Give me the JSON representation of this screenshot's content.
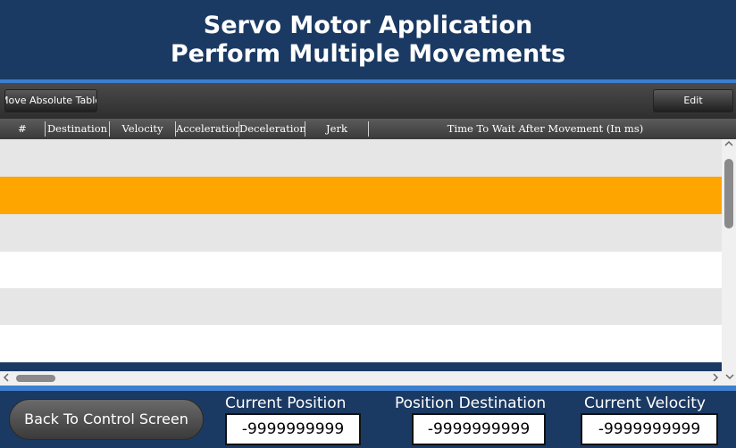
{
  "header": {
    "title_line1": "Servo Motor Application",
    "title_line2": "Perform Multiple Movements"
  },
  "toolbar": {
    "move_label": "Move Absolute Table",
    "edit_label": "Edit"
  },
  "table": {
    "columns": [
      "#",
      "Destination",
      "Velocity",
      "Acceleration",
      "Deceleration",
      "Jerk",
      "Time To Wait After Movement (In ms)"
    ],
    "rows": [
      {
        "state": "normal",
        "color": "#e6e6e6"
      },
      {
        "state": "selected",
        "color": "#ffa500"
      },
      {
        "state": "normal",
        "color": "#e6e6e6"
      },
      {
        "state": "normal",
        "color": "#ffffff"
      },
      {
        "state": "normal",
        "color": "#e6e6e6"
      },
      {
        "state": "normal",
        "color": "#ffffff"
      }
    ]
  },
  "footer": {
    "back_label": "Back To Control Screen",
    "current_position_label": "Current Position",
    "current_position_value": "-9999999999",
    "position_destination_label": "Position Destination",
    "position_destination_value": "-9999999999",
    "current_velocity_label": "Current Velocity",
    "current_velocity_value": "-9999999999"
  },
  "colors": {
    "header_bg": "#1b3a63",
    "accent": "#3d7fcf",
    "selected_row": "#ffa500"
  },
  "icons": [
    "chevron-up-icon",
    "chevron-down-icon",
    "chevron-left-icon",
    "chevron-right-icon"
  ]
}
